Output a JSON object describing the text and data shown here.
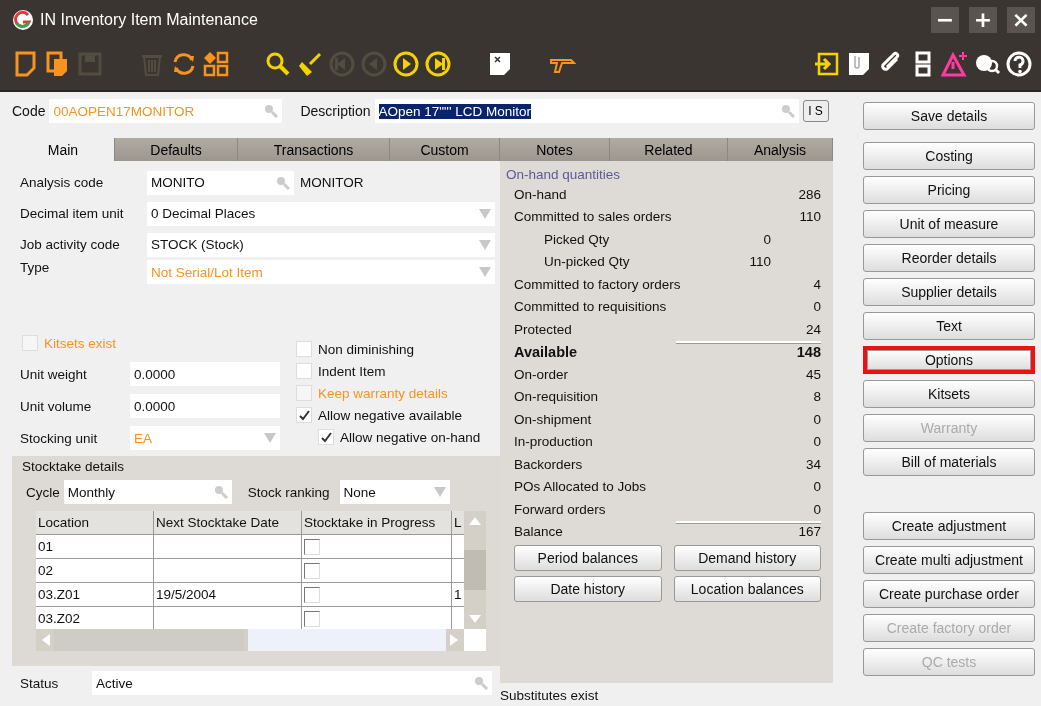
{
  "window": {
    "title": "IN Inventory Item Maintenance",
    "controls": [
      "−",
      "+",
      "×"
    ]
  },
  "toolbar": [
    {
      "kind": "new",
      "disabled": false
    },
    {
      "kind": "copy",
      "disabled": false
    },
    {
      "kind": "save",
      "disabled": true
    },
    {
      "kind": "sep"
    },
    {
      "kind": "delete",
      "disabled": true
    },
    {
      "kind": "refresh",
      "disabled": false
    },
    {
      "kind": "shapes",
      "disabled": false
    },
    {
      "kind": "sep"
    },
    {
      "kind": "search",
      "disabled": false
    },
    {
      "kind": "clear",
      "disabled": false
    },
    {
      "kind": "first",
      "disabled": true
    },
    {
      "kind": "prev",
      "disabled": true
    },
    {
      "kind": "next",
      "disabled": false
    },
    {
      "kind": "last",
      "disabled": false
    },
    {
      "kind": "sep"
    },
    {
      "kind": "note",
      "disabled": false
    },
    {
      "kind": "sep"
    },
    {
      "kind": "scanner",
      "disabled": false
    },
    {
      "kind": "gap"
    },
    {
      "kind": "exit",
      "disabled": false
    },
    {
      "kind": "attach",
      "disabled": false
    },
    {
      "kind": "clip",
      "disabled": false
    },
    {
      "kind": "layout",
      "disabled": false
    },
    {
      "kind": "alert",
      "disabled": false
    },
    {
      "kind": "globe",
      "disabled": false
    },
    {
      "kind": "help",
      "disabled": false
    }
  ],
  "code": {
    "label": "Code",
    "value": "00AOPEN17MONITOR",
    "highlighted": true
  },
  "description": {
    "label": "Description",
    "value": "AOpen 17\"\"' LCD Monitor",
    "selected": true,
    "button": "I S"
  },
  "tabs": [
    {
      "label": "Main",
      "selected": true
    },
    {
      "label": "Defaults",
      "selected": false
    },
    {
      "label": "Transactions",
      "selected": false
    },
    {
      "label": "Custom",
      "selected": false
    },
    {
      "label": "Notes",
      "selected": false
    },
    {
      "label": "Related",
      "selected": false
    },
    {
      "label": "Analysis",
      "selected": false
    }
  ],
  "analysis_code": {
    "label": "Analysis code",
    "value": "MONITO",
    "name": "MONITOR"
  },
  "dropdowns": [
    {
      "label": "Decimal item unit",
      "value": "0 Decimal Places",
      "highlighted": false
    },
    {
      "label": "Job activity code",
      "value": "STOCK (Stock)",
      "highlighted": false
    },
    {
      "label": "Type",
      "value": "Not Serial/Lot Item",
      "highlighted": true
    }
  ],
  "kitsets_exist": {
    "label": "Kitsets exist",
    "checked": false,
    "highlighted": true
  },
  "options": [
    {
      "label": "Non diminishing",
      "checked": false,
      "highlighted": false,
      "indented": false
    },
    {
      "label": "Indent Item",
      "checked": false,
      "highlighted": false,
      "indented": false
    },
    {
      "label": "Keep warranty details",
      "checked": false,
      "highlighted": true,
      "indented": false
    },
    {
      "label": "Allow negative available",
      "checked": true,
      "highlighted": false,
      "indented": false
    },
    {
      "label": "Allow negative on-hand",
      "checked": true,
      "highlighted": false,
      "indented": true
    }
  ],
  "unit_fields": [
    {
      "label": "Unit weight",
      "value": "0.0000",
      "kind": "text",
      "highlighted": false
    },
    {
      "label": "Unit volume",
      "value": "0.0000",
      "kind": "text",
      "highlighted": false
    },
    {
      "label": "Stocking unit",
      "value": "EA",
      "kind": "dropdown",
      "highlighted": true
    }
  ],
  "stocktake": {
    "title": "Stocktake details",
    "cycle_label": "Cycle",
    "cycle": "Monthly",
    "ranking_label": "Stock ranking",
    "ranking": "None",
    "columns": [
      "Location",
      "Next Stocktake Date",
      "Stocktake in Progress",
      "L"
    ],
    "rows": [
      {
        "location": "01",
        "next_date": "",
        "in_progress": false,
        "column_4": ""
      },
      {
        "location": "02",
        "next_date": "",
        "in_progress": false,
        "column_4": ""
      },
      {
        "location": "03.Z01",
        "next_date": "19/5/2004",
        "in_progress": false,
        "column_4": "1"
      },
      {
        "location": "03.Z02",
        "next_date": "",
        "in_progress": false,
        "column_4": ""
      }
    ]
  },
  "status": {
    "label": "Status",
    "value": "Active"
  },
  "quantities": {
    "title": "On-hand quantities",
    "rows": [
      {
        "label": "On-hand",
        "value": "286",
        "kind": "row",
        "ruled": false
      },
      {
        "label": "Committed to sales orders",
        "value": "110",
        "kind": "row",
        "ruled": false
      },
      {
        "label": "Picked Qty",
        "value": "0",
        "kind": "sub",
        "ruled": false
      },
      {
        "label": "Un-picked Qty",
        "value": "110",
        "kind": "sub",
        "ruled": false
      },
      {
        "label": "Committed to factory orders",
        "value": "4",
        "kind": "row",
        "ruled": false
      },
      {
        "label": "Committed to requisitions",
        "value": "0",
        "kind": "row",
        "ruled": false
      },
      {
        "label": "Protected",
        "value": "24",
        "kind": "row",
        "ruled": false
      },
      {
        "label": "Available",
        "value": "148",
        "kind": "total",
        "ruled": true
      },
      {
        "label": "On-order",
        "value": "45",
        "kind": "row",
        "ruled": false
      },
      {
        "label": "On-requisition",
        "value": "8",
        "kind": "row",
        "ruled": false
      },
      {
        "label": "On-shipment",
        "value": "0",
        "kind": "row",
        "ruled": false
      },
      {
        "label": "In-production",
        "value": "0",
        "kind": "row",
        "ruled": false
      },
      {
        "label": "Backorders",
        "value": "34",
        "kind": "row",
        "ruled": false
      },
      {
        "label": "POs Allocated to Jobs",
        "value": "0",
        "kind": "row",
        "ruled": false
      },
      {
        "label": "Forward orders",
        "value": "0",
        "kind": "row",
        "ruled": false
      },
      {
        "label": "Balance",
        "value": "167",
        "kind": "row",
        "ruled": true
      }
    ],
    "buttons": [
      "Period balances",
      "Demand history",
      "Date history",
      "Location balances"
    ]
  },
  "substitutes": "Substitutes exist",
  "side_buttons": [
    {
      "label": "Save details",
      "disabled": false,
      "highlighted": false
    },
    {
      "label": "Costing",
      "disabled": false,
      "highlighted": false
    },
    {
      "label": "Pricing",
      "disabled": false,
      "highlighted": false
    },
    {
      "label": "Unit of measure",
      "disabled": false,
      "highlighted": false
    },
    {
      "label": "Reorder details",
      "disabled": false,
      "highlighted": false
    },
    {
      "label": "Supplier details",
      "disabled": false,
      "highlighted": false
    },
    {
      "label": "Text",
      "disabled": false,
      "highlighted": false
    },
    {
      "label": "Options",
      "disabled": false,
      "highlighted": true
    },
    {
      "label": "Kitsets",
      "disabled": false,
      "highlighted": false
    },
    {
      "label": "Warranty",
      "disabled": true,
      "highlighted": false
    },
    {
      "label": "Bill of materials",
      "disabled": false,
      "highlighted": false
    }
  ],
  "action_buttons": [
    {
      "label": "Create adjustment",
      "disabled": false,
      "highlighted": false
    },
    {
      "label": "Create multi adjustment",
      "disabled": false,
      "highlighted": false
    },
    {
      "label": "Create purchase order",
      "disabled": false,
      "highlighted": false
    },
    {
      "label": "Create factory order",
      "disabled": true,
      "highlighted": false
    },
    {
      "label": "QC tests",
      "disabled": true,
      "highlighted": false
    }
  ]
}
